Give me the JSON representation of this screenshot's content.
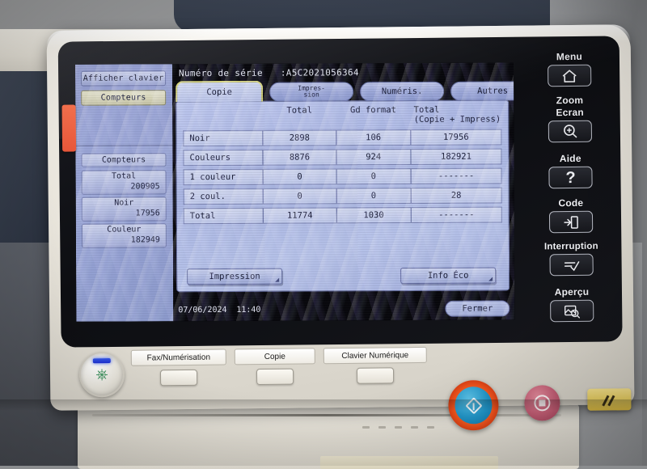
{
  "lcd": {
    "sidebar": {
      "show_keyboard_button": "Afficher clavier",
      "counters_button": "Compteurs",
      "panel_header": "Compteurs",
      "cells": [
        {
          "label": "Total",
          "value": "200905"
        },
        {
          "label": "Noir",
          "value": "17956"
        },
        {
          "label": "Couleur",
          "value": "182949"
        }
      ]
    },
    "serial": {
      "label": "Numéro de série",
      "value": ":A5C2021056364"
    },
    "tabs": [
      {
        "id": "copie",
        "label": "Copie",
        "active": true,
        "two_line": false
      },
      {
        "id": "impression",
        "label": "Impres-",
        "label2": "sion",
        "active": false,
        "two_line": true
      },
      {
        "id": "numeris",
        "label": "Numéris.",
        "active": false,
        "two_line": false
      },
      {
        "id": "autres",
        "label": "Autres",
        "active": false,
        "two_line": false
      }
    ],
    "table": {
      "headers": [
        "",
        "Total",
        "Gd format",
        "Total"
      ],
      "header_total_sub": "(Copie + Impress)",
      "rows": [
        {
          "label": "Noir",
          "total": "2898",
          "gd_format": "106",
          "total_copy_print": "17956"
        },
        {
          "label": "Couleurs",
          "total": "8876",
          "gd_format": "924",
          "total_copy_print": "182921"
        },
        {
          "label": "1 couleur",
          "total": "0",
          "gd_format": "0",
          "total_copy_print": "-------"
        },
        {
          "label": "2 coul.",
          "total": "0",
          "gd_format": "0",
          "total_copy_print": "28"
        },
        {
          "label": "Total",
          "total": "11774",
          "gd_format": "1030",
          "total_copy_print": "-------"
        }
      ]
    },
    "actions": {
      "print_button": "Impression",
      "eco_button": "Info Éco",
      "close_button": "Fermer"
    },
    "status": {
      "date": "07/06/2024",
      "time": "11:40"
    }
  },
  "hardkeys": [
    {
      "id": "menu",
      "label": "Menu",
      "icon": "home-icon"
    },
    {
      "id": "zoom-ecran",
      "label": "Zoom",
      "label2": "Ecran",
      "icon": "magnifier-plus-icon"
    },
    {
      "id": "aide",
      "label": "Aide",
      "icon": "question-mark-icon"
    },
    {
      "id": "code",
      "label": "Code",
      "icon": "login-card-icon"
    },
    {
      "id": "interruption",
      "label": "Interruption",
      "icon": "interrupt-check-icon"
    },
    {
      "id": "apercu",
      "label": "Aperçu",
      "icon": "preview-document-icon"
    }
  ],
  "hardware": {
    "power_button_name": "power-eco-button",
    "softkeys": [
      {
        "id": "fax-scan",
        "label": "Fax/Numérisation"
      },
      {
        "id": "copie",
        "label": "Copie"
      },
      {
        "id": "clavier-num",
        "label": "Clavier Numérique"
      }
    ],
    "start_button_name": "start-button",
    "stop_button_name": "stop-button",
    "reset_button_name": "reset-button"
  },
  "colors": {
    "lcd_blue": "#9aa6d8",
    "tab_active_border": "#d9d77e",
    "start_blue": "#2196c9",
    "start_ring_orange": "#f4591f",
    "stop_red": "#c45f76",
    "reset_yellow": "#e5cb5c",
    "orange_tab": "#e8573a"
  }
}
